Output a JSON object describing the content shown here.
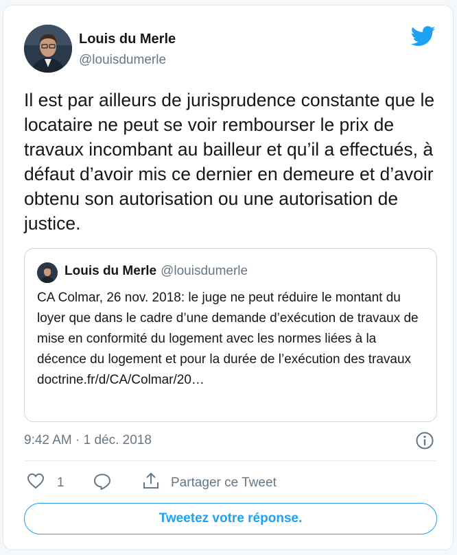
{
  "author": {
    "name": "Louis du Merle",
    "handle": "@louisdumerle"
  },
  "tweet": {
    "text": "Il est par ailleurs de jurisprudence constante que le locataire ne peut se voir rembourser le prix de travaux incombant au bailleur et qu’il a effectués, à défaut d’avoir mis ce dernier en demeure et d’avoir obtenu son autorisation ou une autorisation de justice.",
    "timestamp": "9:42 AM · 1 déc. 2018"
  },
  "quoted_tweet": {
    "name": "Louis du Merle",
    "handle": "@louisdumerle",
    "text": "CA Colmar, 26 nov. 2018: le juge ne peut réduire le montant du loyer que dans le cadre d’une demande d’exécution de travaux de mise en conformité du logement avec les normes liées à la décence du logement et pour la durée de l’exécution des travaux doctrine.fr/d/CA/Colmar/20…"
  },
  "actions": {
    "like_count": "1",
    "share_label": "Partager ce Tweet",
    "reply_button": "Tweetez votre réponse."
  },
  "icons": {
    "brand": "twitter-bird-icon",
    "info": "info-icon",
    "like": "heart-icon",
    "reply": "reply-bubble-icon",
    "share": "share-upload-icon"
  },
  "colors": {
    "accent": "#1da1f2",
    "text": "#14171a",
    "muted": "#657786",
    "border": "#e1e8ed"
  }
}
